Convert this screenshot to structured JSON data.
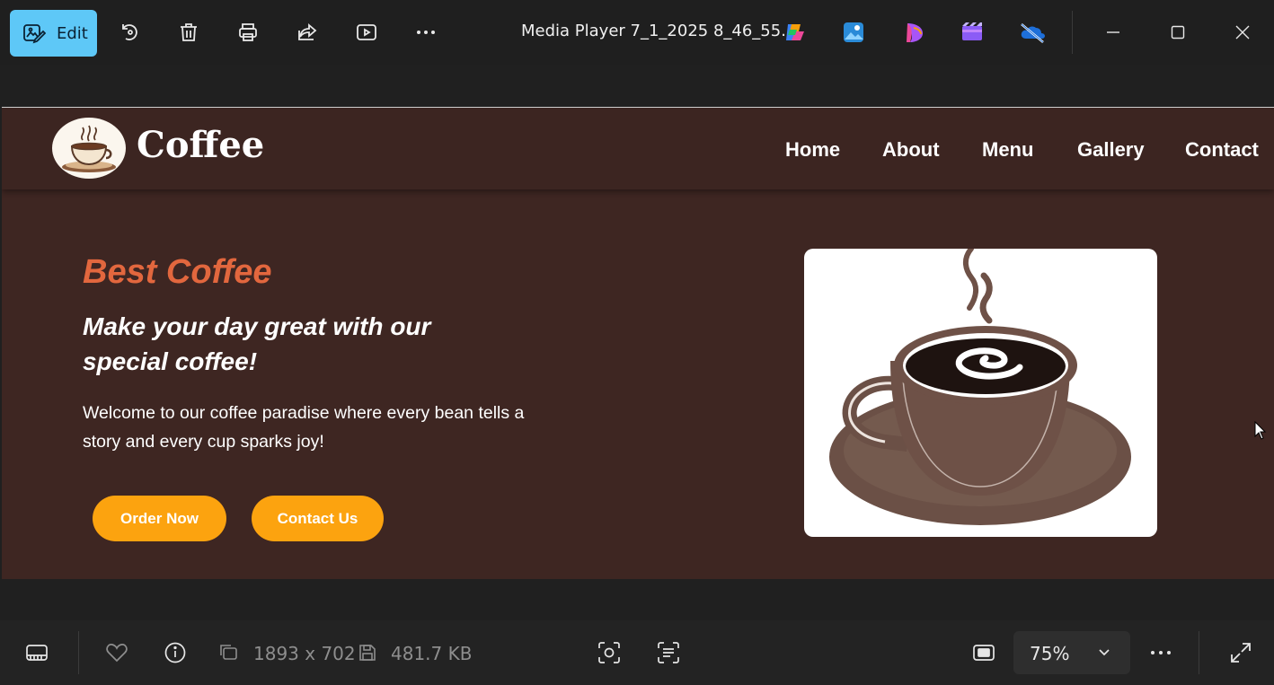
{
  "toolbar": {
    "edit_label": "Edit",
    "window_title": "Media Player 7_1_2025 8_46_55...",
    "icons": [
      "edit-icon",
      "rotate-icon",
      "delete-icon",
      "print-icon",
      "share-icon",
      "slideshow-icon",
      "more-icon",
      "copilot-icon",
      "photos-icon",
      "designer-icon",
      "clipchamp-icon",
      "onedrive-icon",
      "minimize-icon",
      "maximize-icon",
      "close-icon"
    ],
    "accent": "#5ec8f7"
  },
  "website": {
    "brand": "Coffee",
    "nav": [
      "Home",
      "About",
      "Menu",
      "Gallery",
      "Contact"
    ],
    "hero": {
      "tagline": "Best Coffee",
      "title": "Make your day great with our special coffee!",
      "text": "Welcome to our coffee paradise where every bean tells a story and every cup sparks joy!",
      "primary_button": "Order Now",
      "secondary_button": "Contact Us"
    },
    "colors": {
      "background": "#3e2622",
      "tagline": "#e2673e",
      "button": "#fca30f"
    }
  },
  "status": {
    "dimensions": "1893 x 702",
    "file_size": "481.7 KB",
    "zoom": "75%"
  }
}
